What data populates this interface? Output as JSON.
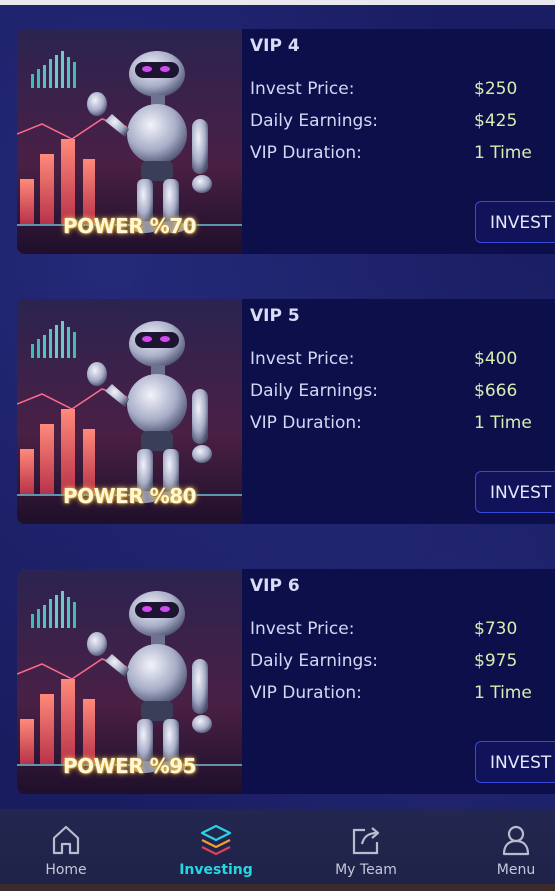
{
  "plans": [
    {
      "title": "VIP 4",
      "power": "POWER %70",
      "rows": [
        {
          "label": "Invest Price:",
          "value": "$250"
        },
        {
          "label": "Daily Earnings:",
          "value": "$425"
        },
        {
          "label": "VIP Duration:",
          "value": "1 Time"
        }
      ],
      "button": "INVEST"
    },
    {
      "title": "VIP 5",
      "power": "POWER %80",
      "rows": [
        {
          "label": "Invest Price:",
          "value": "$400"
        },
        {
          "label": "Daily Earnings:",
          "value": "$666"
        },
        {
          "label": "VIP Duration:",
          "value": "1 Time"
        }
      ],
      "button": "INVEST"
    },
    {
      "title": "VIP 6",
      "power": "POWER %95",
      "rows": [
        {
          "label": "Invest Price:",
          "value": "$730"
        },
        {
          "label": "Daily Earnings:",
          "value": "$975"
        },
        {
          "label": "VIP Duration:",
          "value": "1 Time"
        }
      ],
      "button": "INVEST"
    }
  ],
  "nav": {
    "items": [
      {
        "label": "Home",
        "icon": "home-icon",
        "active": false
      },
      {
        "label": "Investing",
        "icon": "layers-icon",
        "active": true
      },
      {
        "label": "My Team",
        "icon": "share-icon",
        "active": false
      },
      {
        "label": "Menu",
        "icon": "user-icon",
        "active": false
      }
    ]
  },
  "colors": {
    "background": "#16185a",
    "card": "#0d0f4a",
    "value_text": "#d9ecb2",
    "active_nav": "#24d7e0",
    "button_border": "#3a4ad8"
  }
}
